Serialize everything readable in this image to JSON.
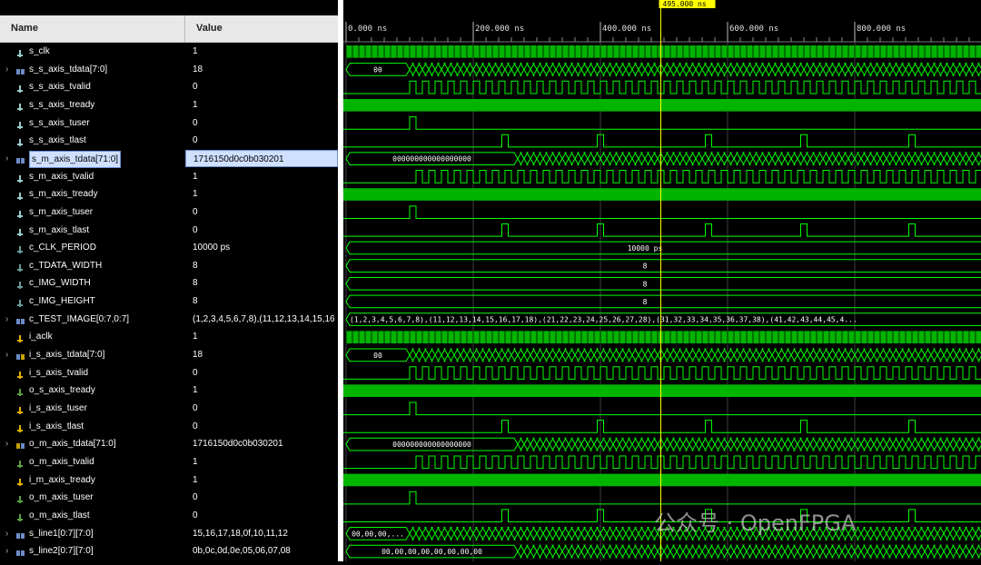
{
  "header": {
    "name_label": "Name",
    "value_label": "Value"
  },
  "cursor": {
    "label": "495.000 ns",
    "time_ns": 495
  },
  "timeline": {
    "ticks": [
      {
        "t": 0,
        "label": "0.000 ns"
      },
      {
        "t": 200,
        "label": "200.000 ns"
      },
      {
        "t": 400,
        "label": "400.000 ns"
      },
      {
        "t": 600,
        "label": "600.000 ns"
      },
      {
        "t": 800,
        "label": "800.000 ns"
      }
    ]
  },
  "colors": {
    "wave": "#00ff00",
    "fill": "#00b400",
    "cursor": "#ffff00",
    "grid": "#404040"
  },
  "signals": [
    {
      "name": "s_clk",
      "value": "1",
      "icon": "wire-icon",
      "bus": false,
      "wave": "clk"
    },
    {
      "name": "s_s_axis_tdata[7:0]",
      "value": "18",
      "icon": "bus-icon",
      "bus": true,
      "wave": "bus",
      "bus_text": "00"
    },
    {
      "name": "s_s_axis_tvalid",
      "value": "0",
      "icon": "wire-icon",
      "bus": false,
      "wave": "valid"
    },
    {
      "name": "s_s_axis_tready",
      "value": "1",
      "icon": "wire-icon",
      "bus": false,
      "wave": "high"
    },
    {
      "name": "s_s_axis_tuser",
      "value": "0",
      "icon": "wire-icon",
      "bus": false,
      "wave": "user"
    },
    {
      "name": "s_s_axis_tlast",
      "value": "0",
      "icon": "wire-icon",
      "bus": false,
      "wave": "last"
    },
    {
      "name": "s_m_axis_tdata[71:0]",
      "value": "1716150d0c0b030201",
      "icon": "bus-icon",
      "bus": true,
      "wave": "wbus",
      "bus_text": "000000000000000000",
      "selected": true
    },
    {
      "name": "s_m_axis_tvalid",
      "value": "1",
      "icon": "wire-icon",
      "bus": false,
      "wave": "mvalid"
    },
    {
      "name": "s_m_axis_tready",
      "value": "1",
      "icon": "wire-icon",
      "bus": false,
      "wave": "high"
    },
    {
      "name": "s_m_axis_tuser",
      "value": "0",
      "icon": "wire-icon",
      "bus": false,
      "wave": "user"
    },
    {
      "name": "s_m_axis_tlast",
      "value": "0",
      "icon": "wire-icon",
      "bus": false,
      "wave": "last"
    },
    {
      "name": "c_CLK_PERIOD",
      "value": "10000 ps",
      "icon": "param-icon",
      "bus": false,
      "wave": "const",
      "bus_text": "10000 ps"
    },
    {
      "name": "c_TDATA_WIDTH",
      "value": "8",
      "icon": "param-icon",
      "bus": false,
      "wave": "const",
      "bus_text": "8"
    },
    {
      "name": "c_IMG_WIDTH",
      "value": "8",
      "icon": "param-icon",
      "bus": false,
      "wave": "const",
      "bus_text": "8"
    },
    {
      "name": "c_IMG_HEIGHT",
      "value": "8",
      "icon": "param-icon",
      "bus": false,
      "wave": "const",
      "bus_text": "8"
    },
    {
      "name": "c_TEST_IMAGE[0:7,0:7]",
      "value": "(1,2,3,4,5,6,7,8),(11,12,13,14,15,16",
      "icon": "param-bus-icon",
      "bus": true,
      "wave": "constlong",
      "bus_text": "(1,2,3,4,5,6,7,8),(11,12,13,14,15,16,17,18),(21,22,23,24,25,26,27,28),(31,32,33,34,35,36,37,38),(41,42,43,44,45,4..."
    },
    {
      "name": "i_aclk",
      "value": "1",
      "icon": "in-icon",
      "bus": false,
      "wave": "clk"
    },
    {
      "name": "i_s_axis_tdata[7:0]",
      "value": "18",
      "icon": "in-bus-icon",
      "bus": true,
      "wave": "bus",
      "bus_text": "00"
    },
    {
      "name": "i_s_axis_tvalid",
      "value": "0",
      "icon": "in-icon",
      "bus": false,
      "wave": "valid"
    },
    {
      "name": "o_s_axis_tready",
      "value": "1",
      "icon": "out-icon",
      "bus": false,
      "wave": "high"
    },
    {
      "name": "i_s_axis_tuser",
      "value": "0",
      "icon": "in-icon",
      "bus": false,
      "wave": "user"
    },
    {
      "name": "i_s_axis_tlast",
      "value": "0",
      "icon": "in-icon",
      "bus": false,
      "wave": "last"
    },
    {
      "name": "o_m_axis_tdata[71:0]",
      "value": "1716150d0c0b030201",
      "icon": "out-bus-icon",
      "bus": true,
      "wave": "wbus",
      "bus_text": "000000000000000000"
    },
    {
      "name": "o_m_axis_tvalid",
      "value": "1",
      "icon": "out-icon",
      "bus": false,
      "wave": "mvalid"
    },
    {
      "name": "i_m_axis_tready",
      "value": "1",
      "icon": "in-icon",
      "bus": false,
      "wave": "high"
    },
    {
      "name": "o_m_axis_tuser",
      "value": "0",
      "icon": "out-icon",
      "bus": false,
      "wave": "user"
    },
    {
      "name": "o_m_axis_tlast",
      "value": "0",
      "icon": "out-icon",
      "bus": false,
      "wave": "last"
    },
    {
      "name": "s_line1[0:7][7:0]",
      "value": "15,16,17,18,0f,10,11,12",
      "icon": "bus-icon",
      "bus": true,
      "wave": "line1",
      "bus_text": "00,00,00,..."
    },
    {
      "name": "s_line2[0:7][7:0]",
      "value": "0b,0c,0d,0e,05,06,07,08",
      "icon": "bus-icon",
      "bus": true,
      "wave": "line2",
      "bus_text": "00,00,00,00,00,00,00,00"
    }
  ],
  "watermark": "公众号 · OpenFPGA"
}
